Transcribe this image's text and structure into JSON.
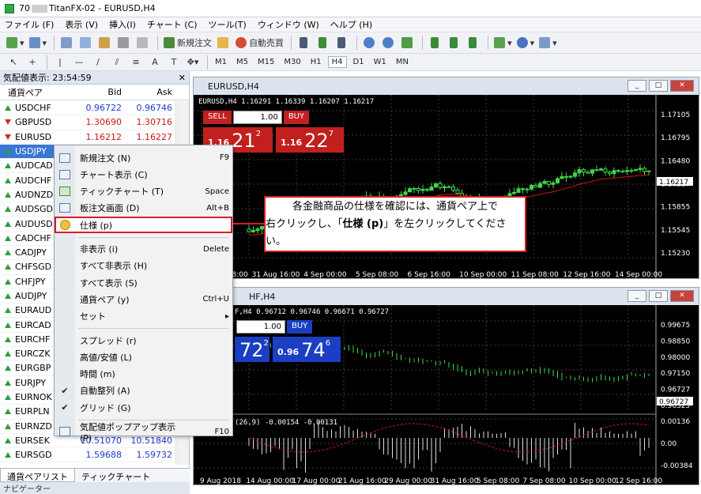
{
  "window": {
    "title_prefix": "70",
    "title": "TitanFX-02 - EURUSD,H4"
  },
  "menu": [
    "ファイル (F)",
    "表示 (V)",
    "挿入(I)",
    "チャート (C)",
    "ツール(T)",
    "ウィンドウ (W)",
    "ヘルプ (H)"
  ],
  "toolbar": {
    "new_order": "新規注文",
    "auto_trade": "自動売買"
  },
  "timeframes": [
    "M1",
    "M5",
    "M15",
    "M30",
    "H1",
    "H4",
    "D1",
    "W1",
    "MN"
  ],
  "active_timeframe": "H4",
  "market_watch": {
    "title": "気配値表示: 23:54:59",
    "columns": {
      "symbol": "通貨ペア",
      "bid": "Bid",
      "ask": "Ask"
    },
    "rows": [
      {
        "symbol": "USDCHF",
        "dir": "up",
        "bid": "0.96722",
        "ask": "0.96746",
        "color": "blue"
      },
      {
        "symbol": "GBPUSD",
        "dir": "down",
        "bid": "1.30690",
        "ask": "1.30716",
        "color": "red"
      },
      {
        "symbol": "EURUSD",
        "dir": "down",
        "bid": "1.16212",
        "ask": "1.16227",
        "color": "red"
      },
      {
        "symbol": "USDJPY",
        "dir": "up",
        "bid": "",
        "ask": "",
        "color": "blue"
      },
      {
        "symbol": "AUDCAD",
        "dir": "up",
        "bid": "",
        "ask": "",
        "color": "blue"
      },
      {
        "symbol": "AUDCHF",
        "dir": "up",
        "bid": "",
        "ask": "",
        "color": "blue"
      },
      {
        "symbol": "AUDNZD",
        "dir": "up",
        "bid": "",
        "ask": "",
        "color": "blue"
      },
      {
        "symbol": "AUDSGD",
        "dir": "up",
        "bid": "",
        "ask": "",
        "color": "blue"
      },
      {
        "symbol": "AUDUSD",
        "dir": "up",
        "bid": "",
        "ask": "",
        "color": "blue"
      },
      {
        "symbol": "CADCHF",
        "dir": "up",
        "bid": "",
        "ask": "",
        "color": "blue"
      },
      {
        "symbol": "CADJPY",
        "dir": "up",
        "bid": "",
        "ask": "",
        "color": "blue"
      },
      {
        "symbol": "CHFSGD",
        "dir": "up",
        "bid": "",
        "ask": "",
        "color": "blue"
      },
      {
        "symbol": "CHFJPY",
        "dir": "up",
        "bid": "",
        "ask": "",
        "color": "blue"
      },
      {
        "symbol": "AUDJPY",
        "dir": "up",
        "bid": "",
        "ask": "",
        "color": "blue"
      },
      {
        "symbol": "EURAUD",
        "dir": "up",
        "bid": "",
        "ask": "",
        "color": "blue"
      },
      {
        "symbol": "EURCAD",
        "dir": "up",
        "bid": "",
        "ask": "",
        "color": "blue"
      },
      {
        "symbol": "EURCHF",
        "dir": "up",
        "bid": "",
        "ask": "",
        "color": "blue"
      },
      {
        "symbol": "EURCZK",
        "dir": "up",
        "bid": "",
        "ask": "",
        "color": "blue"
      },
      {
        "symbol": "EURGBP",
        "dir": "up",
        "bid": "",
        "ask": "",
        "color": "blue"
      },
      {
        "symbol": "EURJPY",
        "dir": "up",
        "bid": "",
        "ask": "",
        "color": "blue"
      },
      {
        "symbol": "EURNOK",
        "dir": "up",
        "bid": "",
        "ask": "",
        "color": "blue"
      },
      {
        "symbol": "EURPLN",
        "dir": "up",
        "bid": "",
        "ask": "",
        "color": "blue"
      },
      {
        "symbol": "EURNZD",
        "dir": "up",
        "bid": "",
        "ask": "",
        "color": "blue"
      },
      {
        "symbol": "EURSEK",
        "dir": "up",
        "bid": "10.51070",
        "ask": "10.51840",
        "color": "blue"
      },
      {
        "symbol": "EURSGD",
        "dir": "up",
        "bid": "1.59688",
        "ask": "1.59732",
        "color": "blue"
      }
    ],
    "selected_symbol": "USDJPY",
    "tabs": [
      "通貨ペアリスト",
      "ティックチャート"
    ],
    "navigator": "ナビゲーター"
  },
  "context_menu": [
    {
      "label": "新規注文 (N)",
      "shortcut": "F9",
      "icon": "new-order-icon"
    },
    {
      "label": "チャート表示 (C)",
      "shortcut": "",
      "icon": "chart-window-icon"
    },
    {
      "label": "ティックチャート (T)",
      "shortcut": "Space",
      "icon": "tick-chart-icon"
    },
    {
      "label": "板注文画面 (D)",
      "shortcut": "Alt+B",
      "icon": "depth-of-market-icon"
    },
    {
      "label": "仕様 (p)",
      "shortcut": "",
      "icon": "specification-icon",
      "highlight": true
    },
    {
      "sep": true
    },
    {
      "label": "非表示 (i)",
      "shortcut": "Delete"
    },
    {
      "label": "すべて非表示 (H)",
      "shortcut": ""
    },
    {
      "label": "すべて表示 (S)",
      "shortcut": ""
    },
    {
      "label": "通貨ペア (y)",
      "shortcut": "Ctrl+U"
    },
    {
      "label": "セット",
      "shortcut": "▸"
    },
    {
      "sep": true
    },
    {
      "label": "スプレッド (r)",
      "shortcut": ""
    },
    {
      "label": "高値/安値 (L)",
      "shortcut": ""
    },
    {
      "label": "時間 (m)",
      "shortcut": ""
    },
    {
      "label": "自動整列 (A)",
      "shortcut": "",
      "checked": true
    },
    {
      "label": "グリッド (G)",
      "shortcut": "",
      "checked": true
    },
    {
      "sep": true
    },
    {
      "label": "気配値ポップアップ表示 (P)",
      "shortcut": "F10",
      "icon": "popup-prices-icon"
    }
  ],
  "chart1": {
    "tab_title": "EURUSD,H4",
    "symbol_line": "EURUSD,H4  1.16291 1.16339 1.16207 1.16217",
    "sell": "SELL",
    "buy": "BUY",
    "lots": "1.00",
    "sell_quote": {
      "prefix": "1.16",
      "big": "21",
      "sup": "2"
    },
    "buy_quote": {
      "prefix": "1.16",
      "big": "22",
      "sup": "7"
    },
    "price_labels": [
      "1.17105",
      "1.16795",
      "1.16480",
      "1.16217",
      "1.15855",
      "1.15545",
      "1.15230"
    ],
    "current_price": "1.16217",
    "date_labels": [
      "30 Aug 08:00",
      "31 Aug 16:00",
      "4 Sep 00:00",
      "5 Sep 08:00",
      "6 Sep 16:00",
      "10 Sep 00:00",
      "11 Sep 08:00",
      "12 Sep 16:00",
      "14 Sep 00:00"
    ]
  },
  "chart2": {
    "tab_title": "HF,H4",
    "symbol_line": "F,H4  0.96712 0.96746 0.96671 0.96727",
    "buy": "BUY",
    "lots": "1.00",
    "sell_quote": {
      "big": "72",
      "sup": "2"
    },
    "buy_quote": {
      "prefix": "0.96",
      "big": "74",
      "sup": "6"
    },
    "price_labels": [
      "0.99675",
      "0.98850",
      "0.98000",
      "0.97150",
      "0.96727",
      "0.96325"
    ],
    "current_price": "0.96727",
    "indicator_line": "(26,9) -0.00154 -0.00131",
    "indicator_labels": [
      "0.00136",
      "0.00",
      "-0.00384"
    ],
    "date_labels": [
      "9 Aug 2018",
      "14 Aug 00:00",
      "17 Aug 00:00",
      "21 Aug 16:00",
      "29 Aug 00:00",
      "31 Aug 16:00",
      "5 Sep 08:00",
      "7 Sep 08:00",
      "10 Sep 00:00",
      "12 Sep 16:00"
    ]
  },
  "callout": {
    "line1": "各金融商品の仕様を確認には、通貨ペア上で",
    "line2_pre": "右クリックし、「",
    "line2_bold": "仕様 (p)",
    "line2_post": "」を左クリックしてください。"
  },
  "colors": {
    "highlight": "#d41f1f",
    "selected_row": "#3a77d4",
    "candle_green": "#3bd84c",
    "ma_red": "#d21414"
  }
}
